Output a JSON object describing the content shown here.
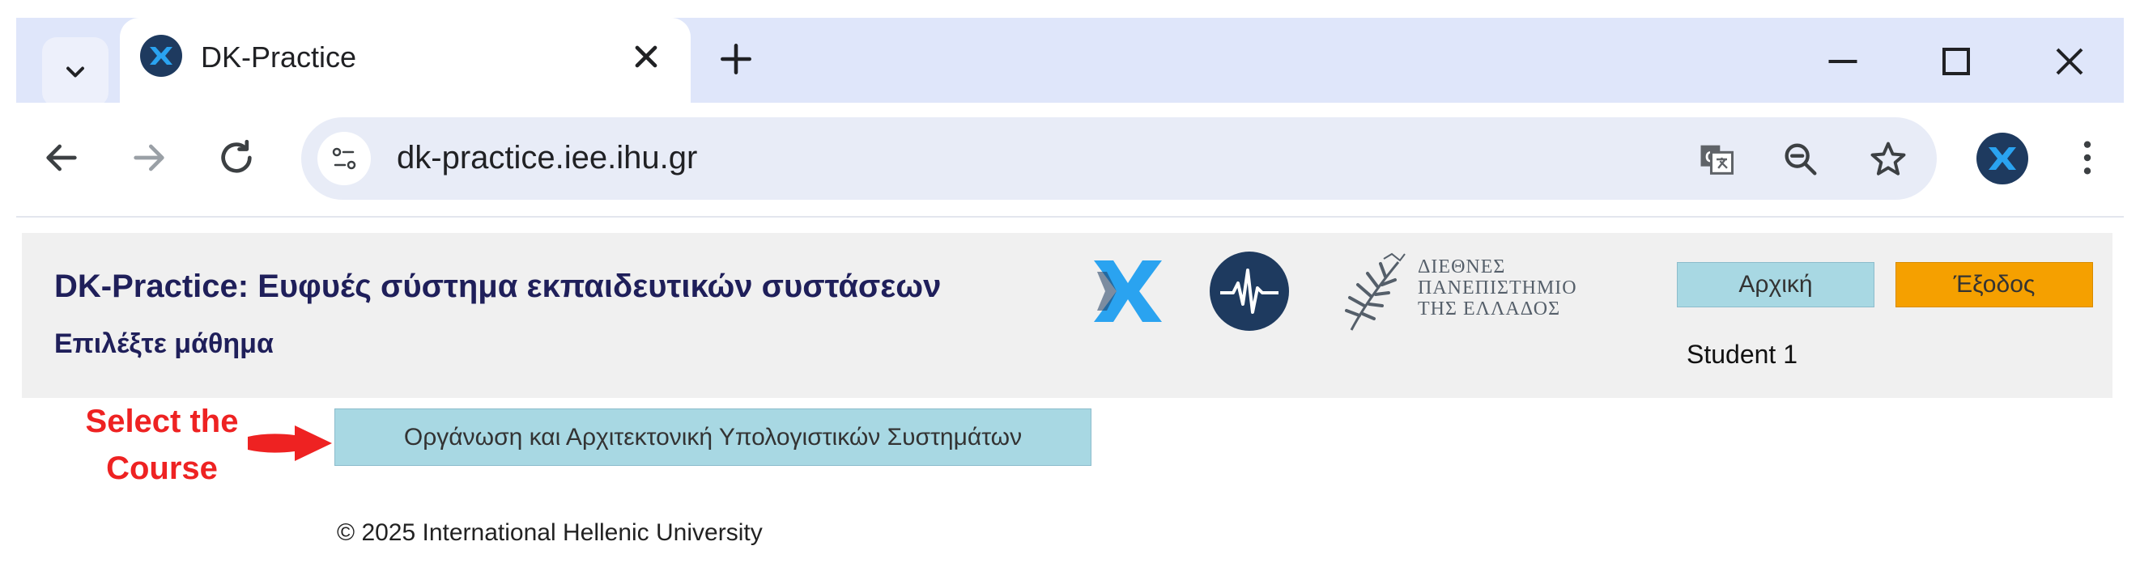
{
  "browser": {
    "tab": {
      "title": "DK-Practice"
    },
    "address": {
      "url": "dk-practice.iee.ihu.gr"
    },
    "icons": {
      "tab_search": "chevron-down-icon",
      "favicon": "dk-favicon-icon",
      "close": "close-icon",
      "new_tab": "plus-icon",
      "minimize": "minimize-icon",
      "maximize": "maximize-icon",
      "window_close": "window-close-icon",
      "back": "back-arrow-icon",
      "forward": "forward-arrow-icon",
      "reload": "reload-icon",
      "site_info": "site-info-icon",
      "translate": "translate-icon",
      "zoom": "zoom-out-icon",
      "bookmark": "star-icon",
      "profile": "profile-icon",
      "menu": "more-vert-icon"
    }
  },
  "header": {
    "title": "DK-Practice: Ευφυές σύστημα εκπαιδευτικών συστάσεων",
    "subtitle": "Επιλέξτε μάθημα",
    "ihu_logo_lines": [
      "ΔΙΕΘΝΕΣ",
      "ΠΑΝΕΠΙΣΤΗΜΙΟ",
      "ΤΗΣ ΕΛΛΑΔΟΣ"
    ],
    "home_button": "Αρχική",
    "logout_button": "Έξοδος",
    "user": "Student 1"
  },
  "main": {
    "annotation_line1": "Select the",
    "annotation_line2": "Course",
    "course_button": "Οργάνωση και Αρχιτεκτονική Υπολογιστικών Συστημάτων"
  },
  "footer": {
    "copyright": "© 2025 International Hellenic University"
  },
  "colors": {
    "tabstrip": "#dfe6fa",
    "header_bg": "#f0f0f0",
    "title": "#1f1f5a",
    "home_button": "#a8d8e3",
    "logout_button": "#f5a000",
    "annotation": "#ee2222"
  }
}
